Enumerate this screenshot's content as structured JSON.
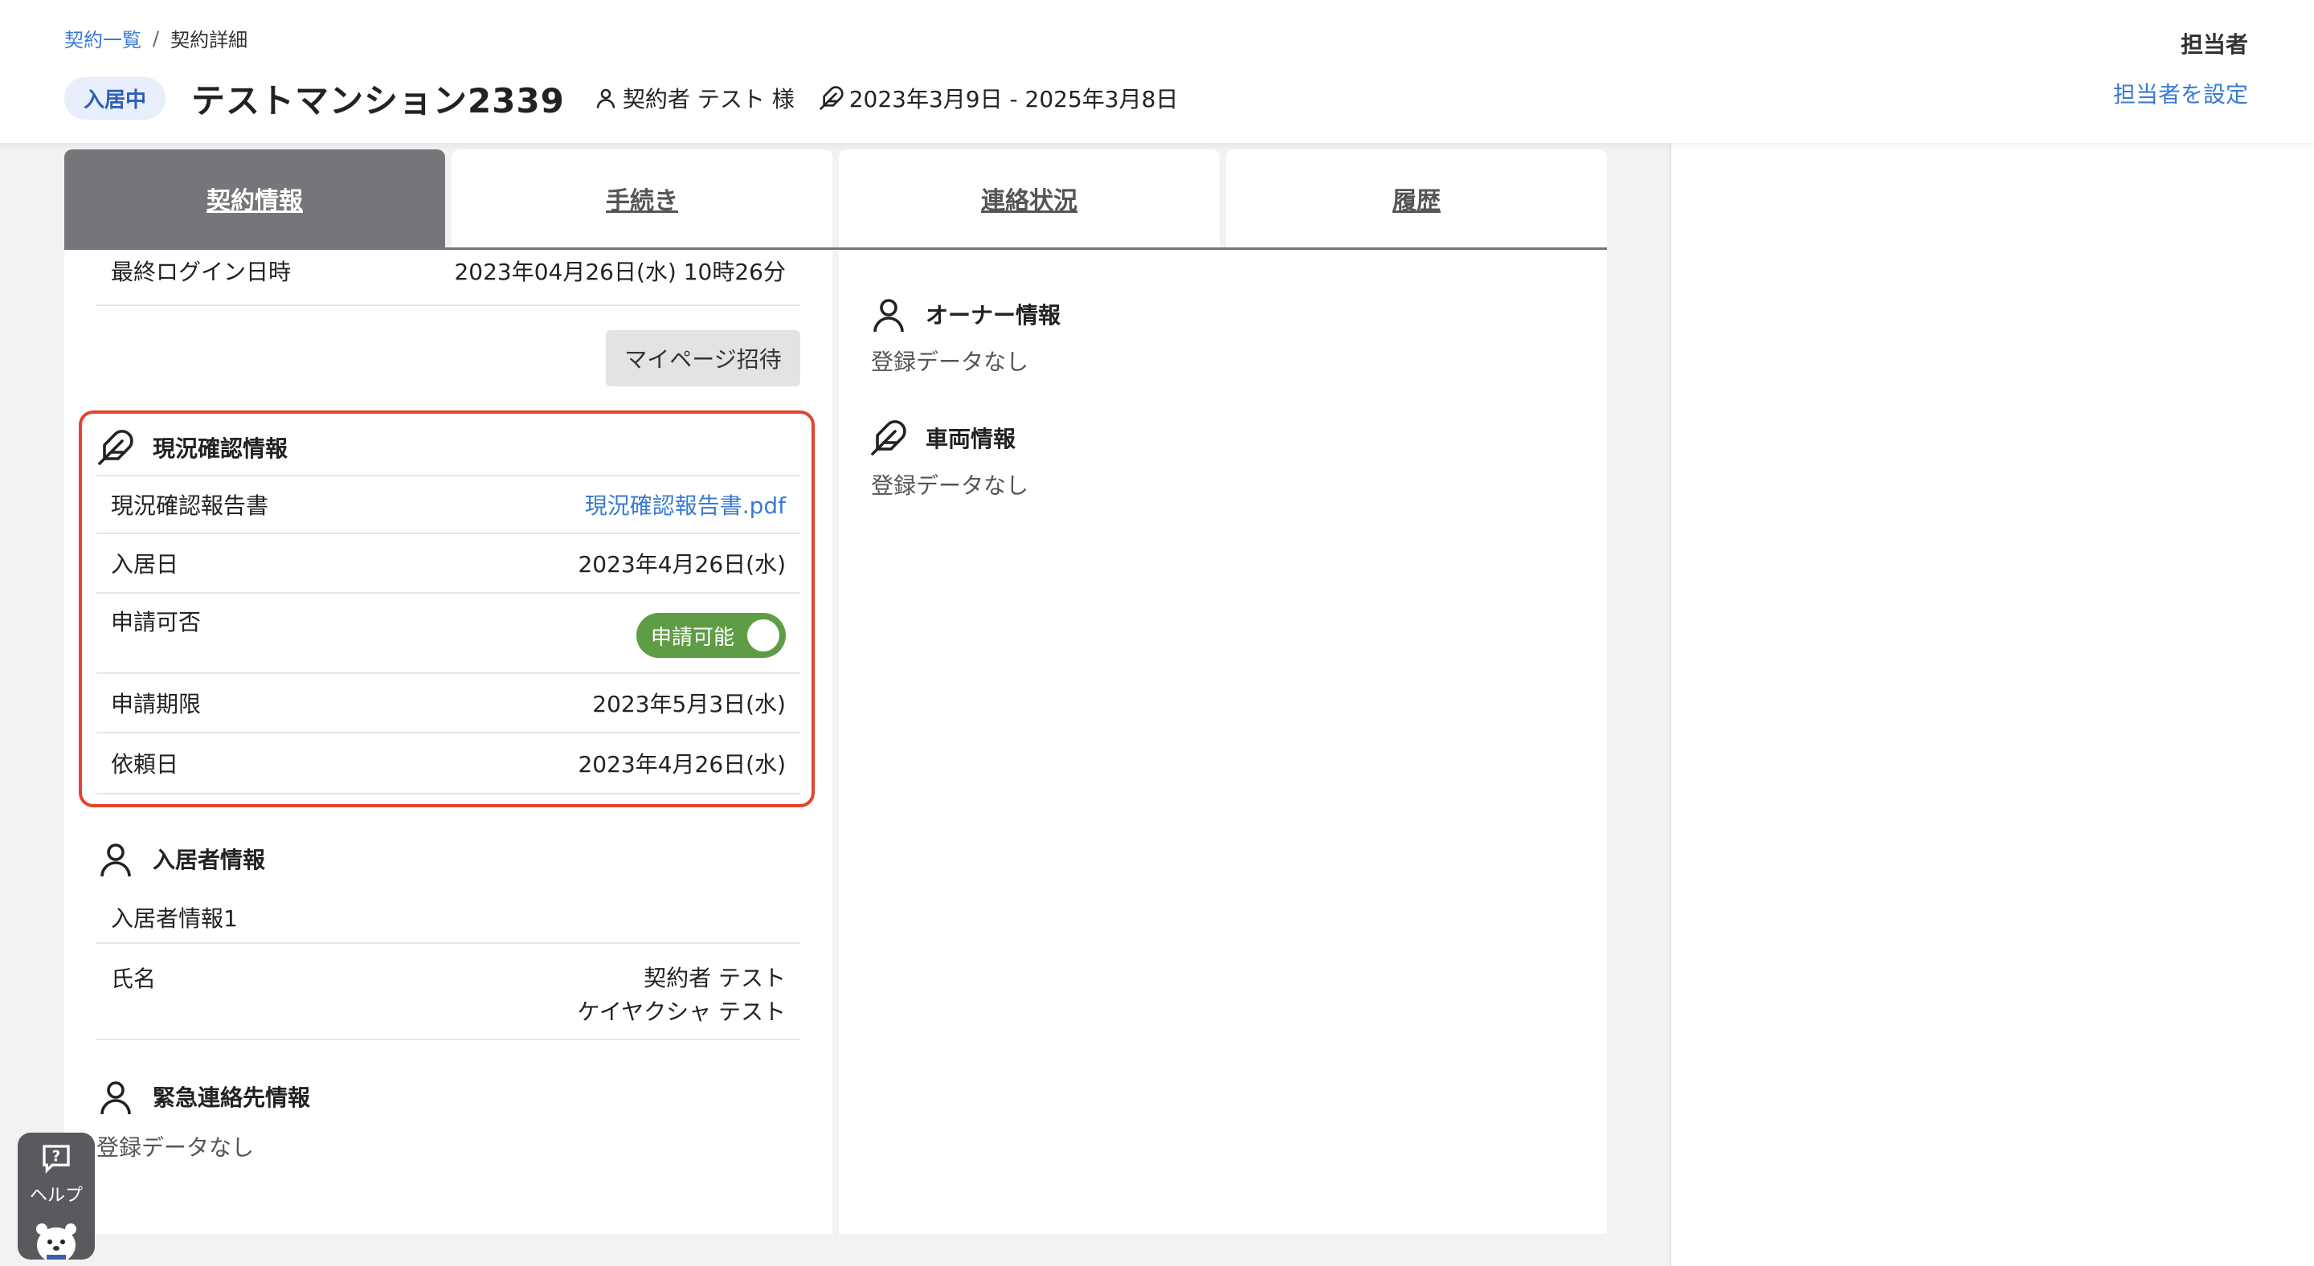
{
  "breadcrumb": {
    "parent": "契約一覧",
    "separator": "/",
    "current": "契約詳細"
  },
  "header": {
    "status": "入居中",
    "title": "テストマンション2339",
    "contractor": "契約者 テスト 様",
    "period": "2023年3月9日 - 2025年3月8日",
    "assignee_label": "担当者",
    "assignee_action": "担当者を設定"
  },
  "tabs": [
    {
      "label": "契約情報",
      "active": true
    },
    {
      "label": "手続き",
      "active": false
    },
    {
      "label": "連絡状況",
      "active": false
    },
    {
      "label": "履歴",
      "active": false
    }
  ],
  "left": {
    "last_login": {
      "label": "最終ログイン日時",
      "value": "2023年04月26日(水) 10時26分"
    },
    "invite_button": "マイページ招待",
    "inspection": {
      "title": "現況確認情報",
      "report": {
        "label": "現況確認報告書",
        "value": "現況確認報告書.pdf"
      },
      "move_in": {
        "label": "入居日",
        "value": "2023年4月26日(水)"
      },
      "application": {
        "label": "申請可否",
        "toggle": "申請可能"
      },
      "deadline": {
        "label": "申請期限",
        "value": "2023年5月3日(水)"
      },
      "request_date": {
        "label": "依頼日",
        "value": "2023年4月26日(水)"
      }
    },
    "residents": {
      "title": "入居者情報",
      "subtitle": "入居者情報1",
      "name_label": "氏名",
      "name": "契約者 テスト",
      "name_kana": "ケイヤクシャ テスト"
    },
    "emergency": {
      "title": "緊急連絡先情報",
      "empty": "登録データなし"
    }
  },
  "right": {
    "owner": {
      "title": "オーナー情報",
      "empty": "登録データなし"
    },
    "vehicle": {
      "title": "車両情報",
      "empty": "登録データなし"
    }
  },
  "help": {
    "label": "ヘルプ"
  },
  "colors": {
    "accent": "#3a7bd5",
    "tab_active": "#75757a",
    "toggle_on": "#5e9d46",
    "highlight": "#e2442f"
  }
}
